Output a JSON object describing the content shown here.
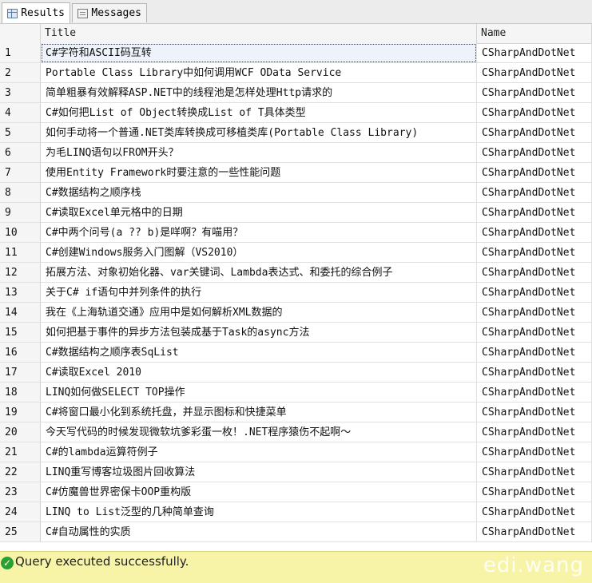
{
  "tabs": [
    {
      "label": "Results",
      "icon": "grid-icon"
    },
    {
      "label": "Messages",
      "icon": "messages-icon"
    }
  ],
  "columns": {
    "num": "",
    "title": "Title",
    "name": "Name"
  },
  "rows": [
    {
      "n": "1",
      "title": "C#字符和ASCII码互转",
      "name": "CSharpAndDotNet"
    },
    {
      "n": "2",
      "title": "Portable Class Library中如何调用WCF OData Service",
      "name": "CSharpAndDotNet"
    },
    {
      "n": "3",
      "title": "简单粗暴有效解释ASP.NET中的线程池是怎样处理Http请求的",
      "name": "CSharpAndDotNet"
    },
    {
      "n": "4",
      "title": "C#如何把List of Object转换成List of T具体类型",
      "name": "CSharpAndDotNet"
    },
    {
      "n": "5",
      "title": "如何手动将一个普通.NET类库转换成可移植类库(Portable Class Library)",
      "name": "CSharpAndDotNet"
    },
    {
      "n": "6",
      "title": "为毛LINQ语句以FROM开头？",
      "name": "CSharpAndDotNet"
    },
    {
      "n": "7",
      "title": "使用Entity Framework时要注意的一些性能问题",
      "name": "CSharpAndDotNet"
    },
    {
      "n": "8",
      "title": "C#数据结构之顺序栈",
      "name": "CSharpAndDotNet"
    },
    {
      "n": "9",
      "title": "C#读取Excel单元格中的日期",
      "name": "CSharpAndDotNet"
    },
    {
      "n": "10",
      "title": "C#中两个问号(a ?? b)是咩啊？有喵用？",
      "name": "CSharpAndDotNet"
    },
    {
      "n": "11",
      "title": "C#创建Windows服务入门图解（VS2010）",
      "name": "CSharpAndDotNet"
    },
    {
      "n": "12",
      "title": "拓展方法、对象初始化器、var关键词、Lambda表达式、和委托的综合例子",
      "name": "CSharpAndDotNet"
    },
    {
      "n": "13",
      "title": "关于C# if语句中并列条件的执行",
      "name": "CSharpAndDotNet"
    },
    {
      "n": "14",
      "title": "我在《上海轨道交通》应用中是如何解析XML数据的",
      "name": "CSharpAndDotNet"
    },
    {
      "n": "15",
      "title": "如何把基于事件的异步方法包装成基于Task的async方法",
      "name": "CSharpAndDotNet"
    },
    {
      "n": "16",
      "title": "C#数据结构之顺序表SqList",
      "name": "CSharpAndDotNet"
    },
    {
      "n": "17",
      "title": "C#读取Excel 2010",
      "name": "CSharpAndDotNet"
    },
    {
      "n": "18",
      "title": "LINQ如何做SELECT TOP操作",
      "name": "CSharpAndDotNet"
    },
    {
      "n": "19",
      "title": "C#将窗口最小化到系统托盘，并显示图标和快捷菜单",
      "name": "CSharpAndDotNet"
    },
    {
      "n": "20",
      "title": "今天写代码的时候发现微软坑爹彩蛋一枚！.NET程序猿伤不起啊～",
      "name": "CSharpAndDotNet"
    },
    {
      "n": "21",
      "title": "C#的lambda运算符例子",
      "name": "CSharpAndDotNet"
    },
    {
      "n": "22",
      "title": "LINQ重写博客垃圾图片回收算法",
      "name": "CSharpAndDotNet"
    },
    {
      "n": "23",
      "title": "C#仿魔兽世界密保卡OOP重构版",
      "name": "CSharpAndDotNet"
    },
    {
      "n": "24",
      "title": "LINQ to List泛型的几种简单查询",
      "name": "CSharpAndDotNet"
    },
    {
      "n": "25",
      "title": "C#自动属性的实质",
      "name": "CSharpAndDotNet"
    }
  ],
  "status": {
    "message": "Query executed successfully.",
    "icon": "success-check-icon",
    "watermark": "edi.wang"
  }
}
